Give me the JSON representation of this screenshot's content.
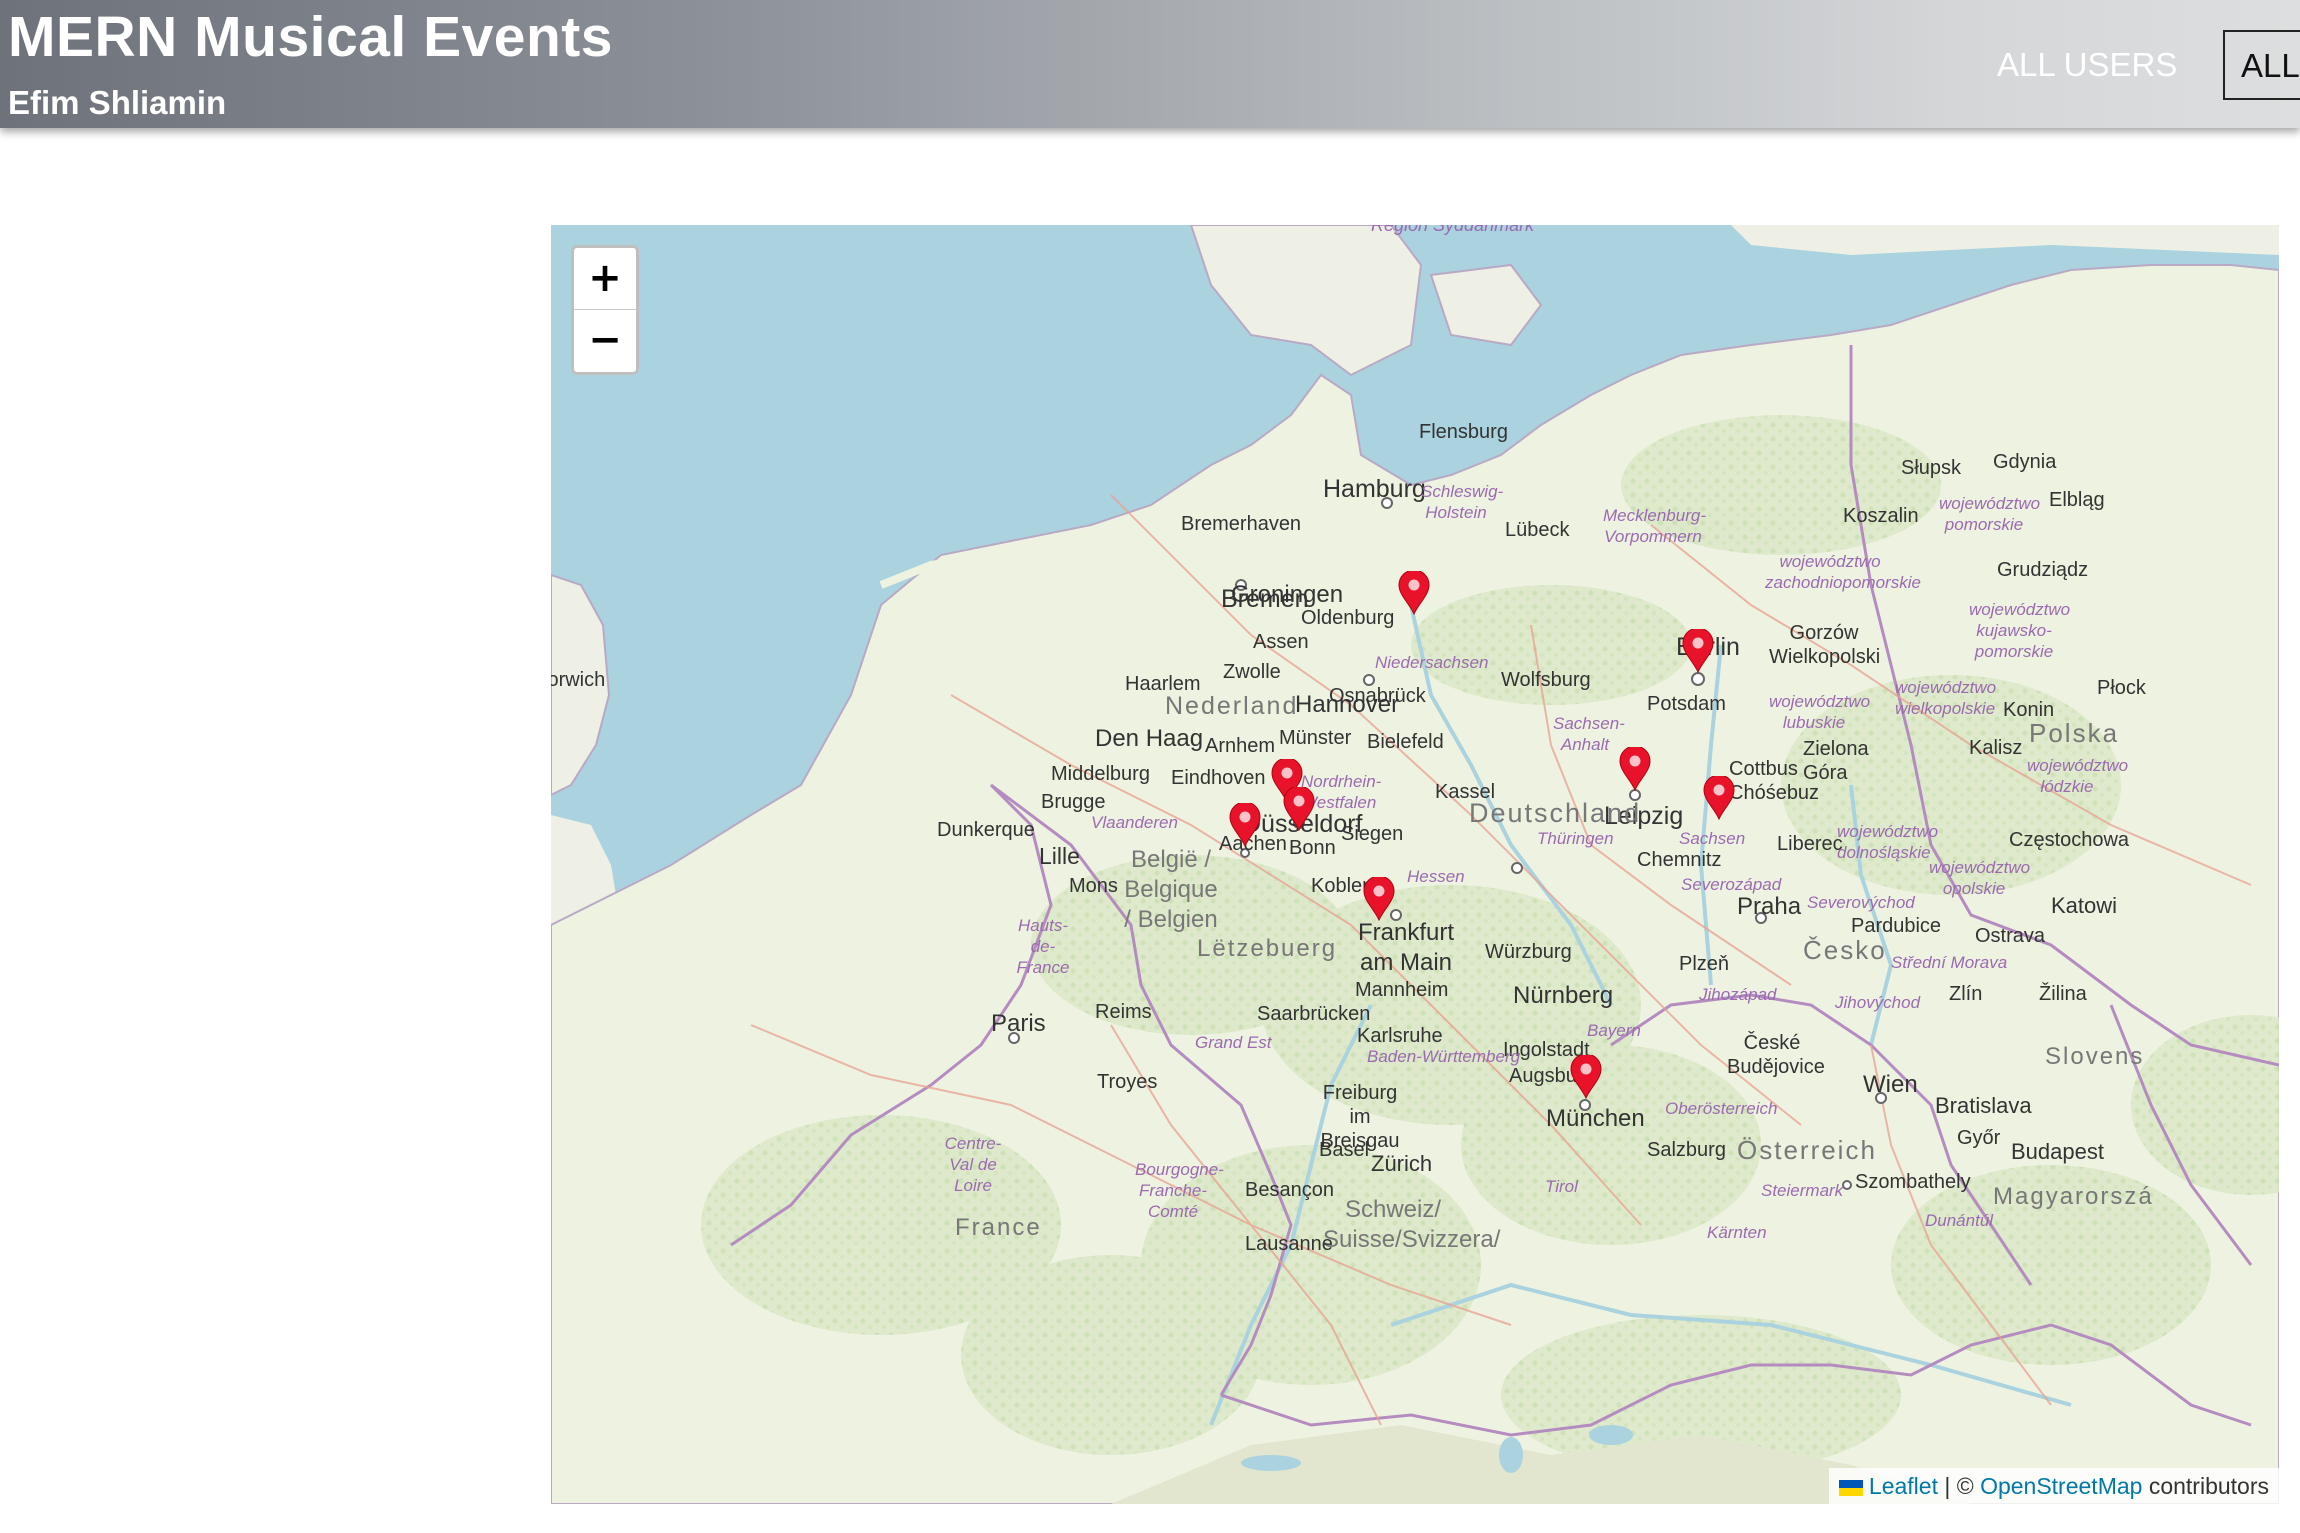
{
  "header": {
    "title": "MERN Musical Events",
    "subtitle": "Efim Shliamin",
    "nav": {
      "all_users": "ALL USERS",
      "all_events": "ALL"
    }
  },
  "map": {
    "zoom_in": "+",
    "zoom_out": "−",
    "attribution": {
      "leaflet": "Leaflet",
      "separator": " | © ",
      "osm": "OpenStreetMap",
      "contributors": " contributors"
    },
    "markers": [
      {
        "name": "Bremerhaven"
      },
      {
        "name": "Berlin"
      },
      {
        "name": "Leipzig"
      },
      {
        "name": "Cottbus"
      },
      {
        "name": "Düsseldorf (north)"
      },
      {
        "name": "Düsseldorf"
      },
      {
        "name": "Aachen"
      },
      {
        "name": "Frankfurt am Main"
      },
      {
        "name": "München"
      }
    ],
    "labels": {
      "hamburg": "Hamburg",
      "bremen": "Bremen",
      "bremerhaven": "Bremerhaven",
      "berlin": "Berlin",
      "hannover": "Hannover",
      "leipzig": "Leipzig",
      "duesseldorf": "Düsseldorf",
      "frankfurt": "Frankfurt am Main",
      "muenchen": "München",
      "nuernberg": "Nürnberg",
      "praha": "Praha",
      "wien": "Wien",
      "paris": "Paris",
      "deutschland": "Deutschland",
      "nederland": "Nederland",
      "belgie": "België / Belgique / Belgien",
      "cesko": "Česko",
      "polska": "Polska",
      "osterreich": "Österreich",
      "schweiz": "Schweiz/ Suisse/Svizzera/",
      "letzebuerg": "Lëtzebuerg",
      "france": "France",
      "groningen": "Groningen",
      "den_haag": "Den Haag",
      "lille": "Lille",
      "flensburg": "Flensburg",
      "luebeck": "Lübeck",
      "wolfsburg": "Wolfsburg",
      "kassel": "Kassel",
      "bonn": "Bonn",
      "koblenz": "Koblenz",
      "mannheim": "Mannheim",
      "karlsruhe": "Karlsruhe",
      "wuerzburg": "Würzburg",
      "augsburg": "Augsburg",
      "ingolstadt": "Ingolstadt",
      "chemnitz": "Chemnitz",
      "potsdam": "Potsdam",
      "osnabrueck": "Osnabrück",
      "muenster": "Münster",
      "bielefeld": "Bielefeld",
      "siegen": "Siegen",
      "aachen": "Aachen",
      "zuerich": "Zürich",
      "basel": "Basel",
      "salzburg": "Salzburg",
      "bratislava": "Bratislava",
      "budapest": "Budapest",
      "koszalin": "Koszalin",
      "gdynia": "Gdynia",
      "slupsk": "Słupsk",
      "zielona_gora": "Zielona Góra",
      "plzen": "Plzeň",
      "ostrava": "Ostrava",
      "zlin": "Zlín",
      "pardubice": "Pardubice",
      "liberec": "Liberec",
      "cottbus": "Cottbus Chóśebuz",
      "saarbruecken": "Saarbrücken",
      "freiburg": "Freiburg im Breisgau",
      "reims": "Reims",
      "troyes": "Troyes",
      "besancon": "Besançon",
      "mons": "Mons",
      "brugge": "Brugge",
      "dunkerque": "Dunkerque",
      "eindhoven": "Eindhoven",
      "arnhem": "Arnhem",
      "zwolle": "Zwolle",
      "assen": "Assen",
      "oldenburg": "Oldenburg",
      "haarlem": "Haarlem",
      "middelburg": "Middelburg",
      "norwich": "Norwich",
      "gyor": "Győr",
      "szombathely": "Szombathely",
      "kalisz": "Kalisz",
      "konin": "Konin",
      "czestochowa": "Częstochowa",
      "grudziadz": "Grudziądz",
      "elblag": "Elbląg",
      "plock": "Płock",
      "gorzow": "Gorzów Wielkopolski",
      "lausanne": "Lausanne",
      "ceske_budejovice": "České Budějovice",
      "zilina": "Žilina",
      "katowice": "Katowi",
      "slovensko": "Slovens",
      "magyarorszag": "Magyarorszá",
      "region_syddanmark": "Region Syddanmark",
      "schleswig": "Schleswig-Holstein",
      "mecklenburg": "Mecklenburg-Vorpommern",
      "niedersachsen": "Niedersachsen",
      "sachsen_anhalt": "Sachsen-Anhalt",
      "nordrhein": "Nordrhein-Westfalen",
      "thueringen": "Thüringen",
      "sachsen": "Sachsen",
      "hessen": "Hessen",
      "bayern": "Bayern",
      "baden": "Baden-Württemberg",
      "vlaanderen": "Vlaanderen",
      "hauts_de_france": "Hauts-de-France",
      "grand_est": "Grand Est",
      "bourgogne": "Bourgogne-Franche-Comté",
      "centre": "Centre-Val de Loire",
      "severozapad": "Severozápad",
      "severovychod": "Severovýchod",
      "jihozapad": "Jihozápad",
      "jihovychod": "Jihovýchod",
      "stredni_morava": "Střední Morava",
      "oberoesterreich": "Oberösterreich",
      "steiermark": "Steiermark",
      "tirol": "Tirol",
      "kaernten": "Kärnten",
      "dunantul": "Dunántúl",
      "zachodniopomorskie": "województwo zachodniopomorskie",
      "pomorskie": "województwo pomorskie",
      "kujawsko": "województwo kujawsko-pomorskie",
      "wielkopolskie": "województwo wielkopolskie",
      "lubuskie": "województwo lubuskie",
      "dolnoslaskie": "województwo dolnośląskie",
      "opolskie": "województwo opolskie",
      "lodzkie": "województwo łódzkie"
    }
  }
}
